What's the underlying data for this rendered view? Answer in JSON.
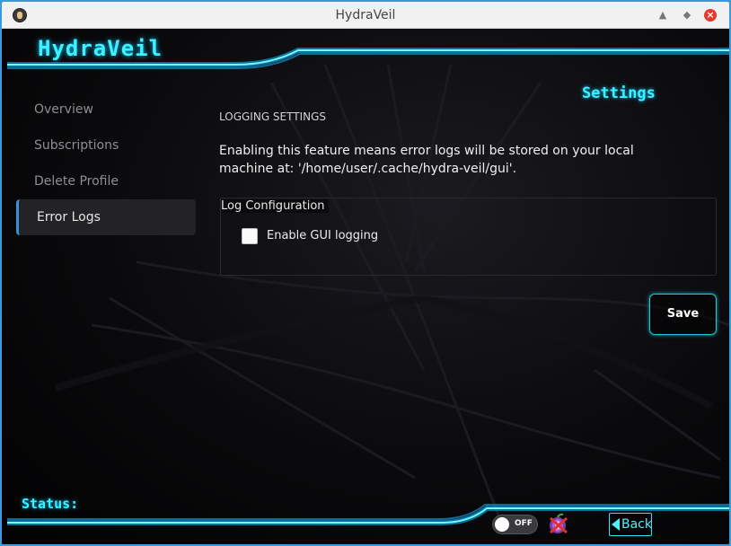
{
  "window": {
    "title": "HydraVeil"
  },
  "app": {
    "logo_text": "HydraVeil"
  },
  "page": {
    "title": "Settings"
  },
  "sidebar": {
    "items": [
      {
        "label": "Overview",
        "active": false
      },
      {
        "label": "Subscriptions",
        "active": false
      },
      {
        "label": "Delete Profile",
        "active": false
      },
      {
        "label": "Error Logs",
        "active": true
      }
    ]
  },
  "main": {
    "section_title": "LOGGING SETTINGS",
    "description": "Enabling this feature means error logs will be stored on your local machine at: '/home/user/.cache/hydra-veil/gui'.",
    "group": {
      "title": "Log Configuration",
      "checkbox_label": "Enable GUI logging",
      "checkbox_checked": false
    },
    "save_label": "Save"
  },
  "footer": {
    "status_label": "Status:",
    "toggle_label": "OFF",
    "back_label": "Back"
  },
  "colors": {
    "accent_cyan": "#3ef1ff",
    "selection_blue": "#3b8fd6",
    "close_red": "#e8382d"
  },
  "icons": {
    "app": "hydraveil-app-icon",
    "minimize": "chevron-up-icon",
    "maximize": "diamond-icon",
    "close": "close-icon",
    "tor": "tor-onion-icon",
    "back": "arrow-left-icon"
  }
}
